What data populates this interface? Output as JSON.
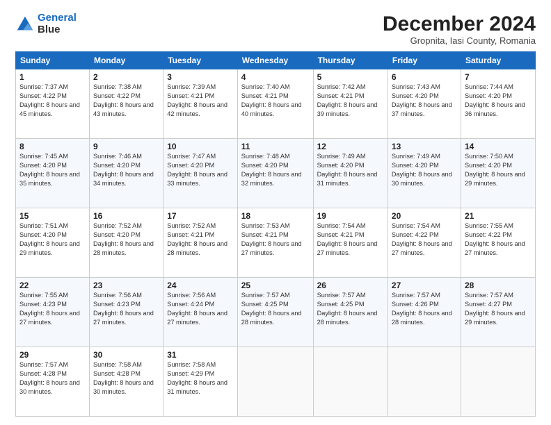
{
  "header": {
    "logo_line1": "General",
    "logo_line2": "Blue",
    "month_title": "December 2024",
    "subtitle": "Gropnita, Iasi County, Romania"
  },
  "weekdays": [
    "Sunday",
    "Monday",
    "Tuesday",
    "Wednesday",
    "Thursday",
    "Friday",
    "Saturday"
  ],
  "weeks": [
    [
      {
        "day": "1",
        "sunrise": "7:37 AM",
        "sunset": "4:22 PM",
        "daylight": "8 hours and 45 minutes."
      },
      {
        "day": "2",
        "sunrise": "7:38 AM",
        "sunset": "4:22 PM",
        "daylight": "8 hours and 43 minutes."
      },
      {
        "day": "3",
        "sunrise": "7:39 AM",
        "sunset": "4:21 PM",
        "daylight": "8 hours and 42 minutes."
      },
      {
        "day": "4",
        "sunrise": "7:40 AM",
        "sunset": "4:21 PM",
        "daylight": "8 hours and 40 minutes."
      },
      {
        "day": "5",
        "sunrise": "7:42 AM",
        "sunset": "4:21 PM",
        "daylight": "8 hours and 39 minutes."
      },
      {
        "day": "6",
        "sunrise": "7:43 AM",
        "sunset": "4:20 PM",
        "daylight": "8 hours and 37 minutes."
      },
      {
        "day": "7",
        "sunrise": "7:44 AM",
        "sunset": "4:20 PM",
        "daylight": "8 hours and 36 minutes."
      }
    ],
    [
      {
        "day": "8",
        "sunrise": "7:45 AM",
        "sunset": "4:20 PM",
        "daylight": "8 hours and 35 minutes."
      },
      {
        "day": "9",
        "sunrise": "7:46 AM",
        "sunset": "4:20 PM",
        "daylight": "8 hours and 34 minutes."
      },
      {
        "day": "10",
        "sunrise": "7:47 AM",
        "sunset": "4:20 PM",
        "daylight": "8 hours and 33 minutes."
      },
      {
        "day": "11",
        "sunrise": "7:48 AM",
        "sunset": "4:20 PM",
        "daylight": "8 hours and 32 minutes."
      },
      {
        "day": "12",
        "sunrise": "7:49 AM",
        "sunset": "4:20 PM",
        "daylight": "8 hours and 31 minutes."
      },
      {
        "day": "13",
        "sunrise": "7:49 AM",
        "sunset": "4:20 PM",
        "daylight": "8 hours and 30 minutes."
      },
      {
        "day": "14",
        "sunrise": "7:50 AM",
        "sunset": "4:20 PM",
        "daylight": "8 hours and 29 minutes."
      }
    ],
    [
      {
        "day": "15",
        "sunrise": "7:51 AM",
        "sunset": "4:20 PM",
        "daylight": "8 hours and 29 minutes."
      },
      {
        "day": "16",
        "sunrise": "7:52 AM",
        "sunset": "4:20 PM",
        "daylight": "8 hours and 28 minutes."
      },
      {
        "day": "17",
        "sunrise": "7:52 AM",
        "sunset": "4:21 PM",
        "daylight": "8 hours and 28 minutes."
      },
      {
        "day": "18",
        "sunrise": "7:53 AM",
        "sunset": "4:21 PM",
        "daylight": "8 hours and 27 minutes."
      },
      {
        "day": "19",
        "sunrise": "7:54 AM",
        "sunset": "4:21 PM",
        "daylight": "8 hours and 27 minutes."
      },
      {
        "day": "20",
        "sunrise": "7:54 AM",
        "sunset": "4:22 PM",
        "daylight": "8 hours and 27 minutes."
      },
      {
        "day": "21",
        "sunrise": "7:55 AM",
        "sunset": "4:22 PM",
        "daylight": "8 hours and 27 minutes."
      }
    ],
    [
      {
        "day": "22",
        "sunrise": "7:55 AM",
        "sunset": "4:23 PM",
        "daylight": "8 hours and 27 minutes."
      },
      {
        "day": "23",
        "sunrise": "7:56 AM",
        "sunset": "4:23 PM",
        "daylight": "8 hours and 27 minutes."
      },
      {
        "day": "24",
        "sunrise": "7:56 AM",
        "sunset": "4:24 PM",
        "daylight": "8 hours and 27 minutes."
      },
      {
        "day": "25",
        "sunrise": "7:57 AM",
        "sunset": "4:25 PM",
        "daylight": "8 hours and 28 minutes."
      },
      {
        "day": "26",
        "sunrise": "7:57 AM",
        "sunset": "4:25 PM",
        "daylight": "8 hours and 28 minutes."
      },
      {
        "day": "27",
        "sunrise": "7:57 AM",
        "sunset": "4:26 PM",
        "daylight": "8 hours and 28 minutes."
      },
      {
        "day": "28",
        "sunrise": "7:57 AM",
        "sunset": "4:27 PM",
        "daylight": "8 hours and 29 minutes."
      }
    ],
    [
      {
        "day": "29",
        "sunrise": "7:57 AM",
        "sunset": "4:28 PM",
        "daylight": "8 hours and 30 minutes."
      },
      {
        "day": "30",
        "sunrise": "7:58 AM",
        "sunset": "4:28 PM",
        "daylight": "8 hours and 30 minutes."
      },
      {
        "day": "31",
        "sunrise": "7:58 AM",
        "sunset": "4:29 PM",
        "daylight": "8 hours and 31 minutes."
      },
      null,
      null,
      null,
      null
    ]
  ]
}
